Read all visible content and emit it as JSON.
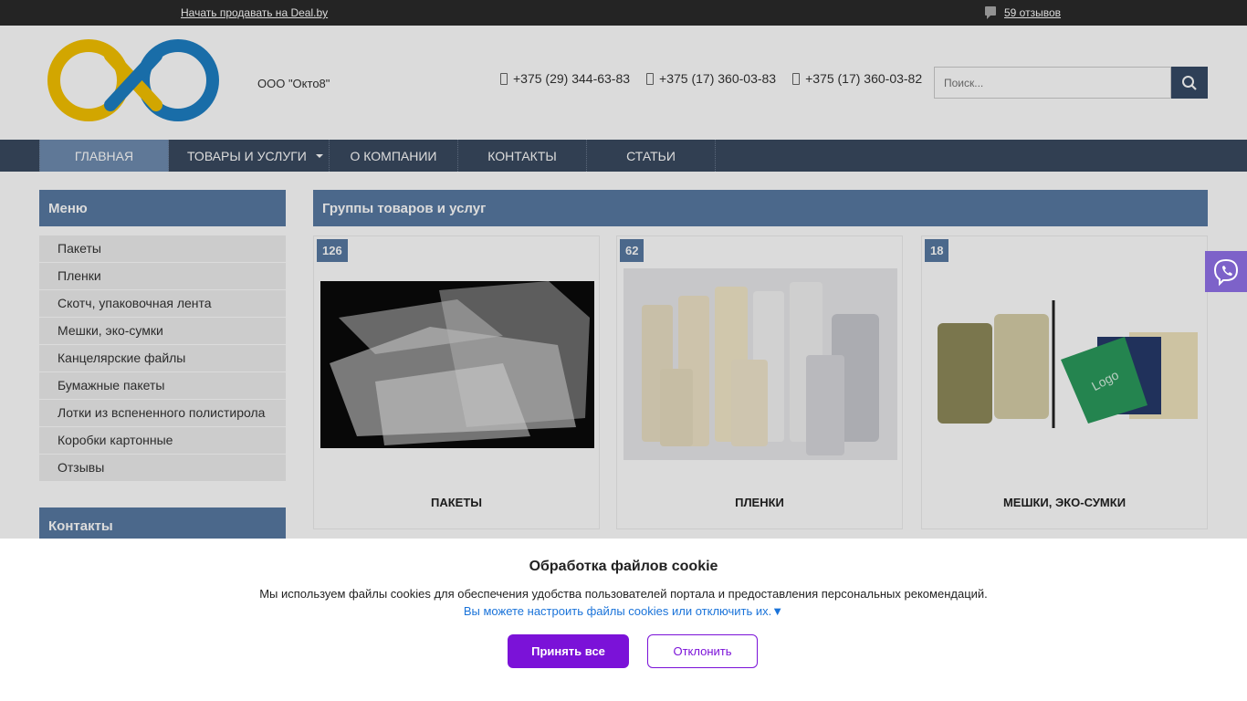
{
  "topbar": {
    "sell_link": "Начать продавать на Deal.by",
    "reviews_link": "59 отзывов",
    "reviews_icon": "comment-icon"
  },
  "header": {
    "company_name": "ООО \"Окто8\"",
    "phones": [
      "+375 (29) 344-63-83",
      "+375 (17) 360-03-83",
      "+375 (17) 360-03-82"
    ],
    "search_placeholder": "Поиск...",
    "search_icon": "search-icon",
    "logo_colors": {
      "yellow": "#f5c200",
      "blue": "#1e7fc4"
    }
  },
  "nav": {
    "items": [
      {
        "label": "ГЛАВНАЯ"
      },
      {
        "label": "ТОВАРЫ И УСЛУГИ"
      },
      {
        "label": "О КОМПАНИИ"
      },
      {
        "label": "КОНТАКТЫ"
      },
      {
        "label": "СТАТЬИ"
      }
    ]
  },
  "sidebar": {
    "menu_title": "Меню",
    "items": [
      {
        "label": "Пакеты"
      },
      {
        "label": "Пленки"
      },
      {
        "label": "Скотч, упаковочная лента"
      },
      {
        "label": "Мешки, эко-сумки"
      },
      {
        "label": "Канцелярские файлы"
      },
      {
        "label": "Бумажные пакеты"
      },
      {
        "label": "Лотки из вспененного полистирола"
      },
      {
        "label": "Коробки картонные"
      },
      {
        "label": "Отзывы"
      }
    ],
    "contacts_title": "Контакты"
  },
  "main": {
    "title": "Группы товаров и услуг",
    "cards": [
      {
        "count": "126",
        "title": "ПАКЕТЫ"
      },
      {
        "count": "62",
        "title": "ПЛЕНКИ"
      },
      {
        "count": "18",
        "title": "МЕШКИ, ЭКО-СУМКИ",
        "image_text": "Logo"
      }
    ]
  },
  "cookie": {
    "title": "Обработка файлов cookie",
    "text": "Мы используем файлы cookies для обеспечения удобства пользователей портала и предоставления персональных рекомендаций.",
    "link": "Вы можете настроить файлы cookies или отключить их.▼",
    "accept_label": "Принять все",
    "decline_label": "Отклонить",
    "accent_color": "#7b12d8"
  },
  "colors": {
    "topbar": "#2b2b2b",
    "nav": "#3a4a60",
    "nav_active": "#6f8cb0",
    "panel_header": "#587aa2",
    "viber": "#7d62c9"
  }
}
